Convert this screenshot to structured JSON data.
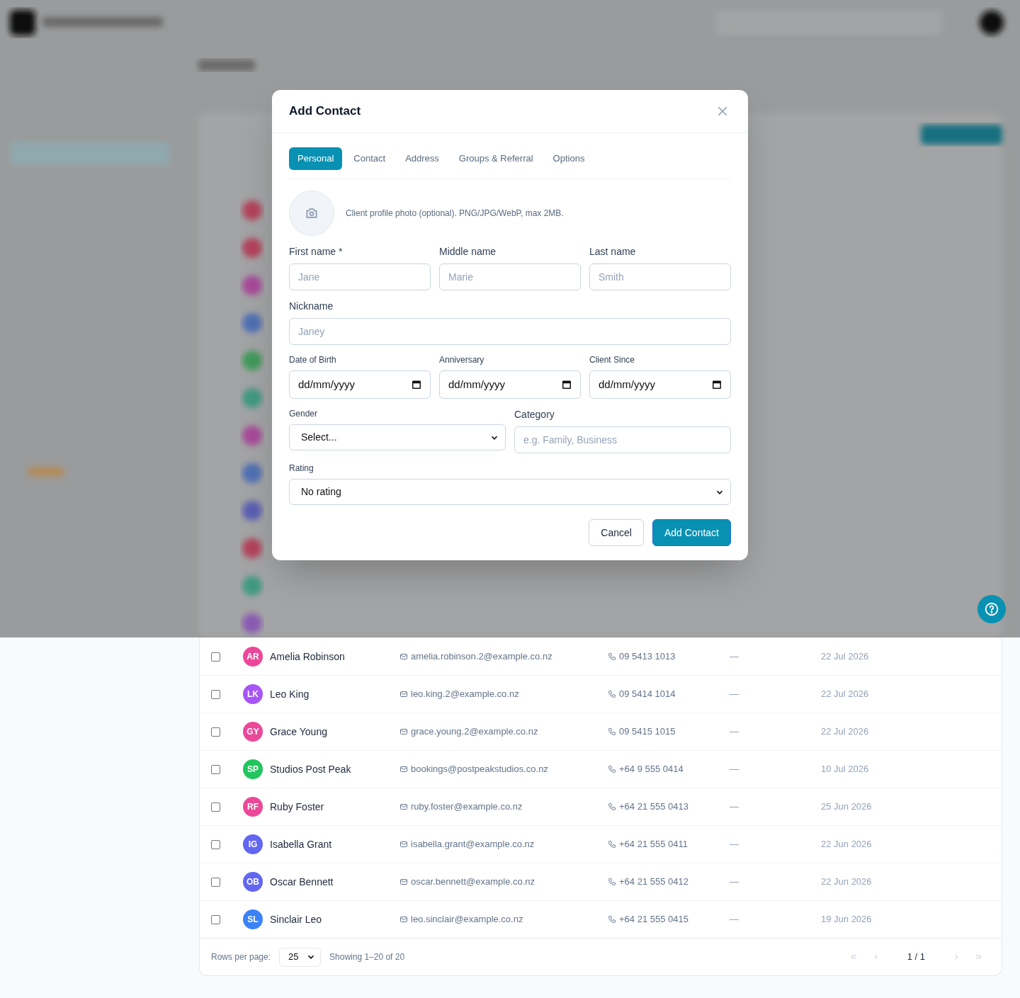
{
  "dialog": {
    "title": "Add Contact",
    "tabs": [
      {
        "label": "Personal",
        "selected": true
      },
      {
        "label": "Contact",
        "selected": false
      },
      {
        "label": "Address",
        "selected": false
      },
      {
        "label": "Groups & Referral",
        "selected": false
      },
      {
        "label": "Options",
        "selected": false
      }
    ],
    "photo_hint": "Client profile photo (optional). PNG/JPG/WebP, max 2MB.",
    "field_rows": [
      [
        {
          "kind": "text",
          "label": "First name *",
          "placeholder": "Jane"
        },
        {
          "kind": "text",
          "label": "Middle name",
          "placeholder": "Marie"
        },
        {
          "kind": "text",
          "label": "Last name",
          "placeholder": "Smith"
        }
      ],
      [
        {
          "kind": "text",
          "label": "Nickname",
          "placeholder": "Janey"
        }
      ],
      [
        {
          "kind": "date",
          "label": "Date of Birth",
          "value": "dd/mm/yyyy"
        },
        {
          "kind": "date",
          "label": "Anniversary",
          "value": "dd/mm/yyyy"
        },
        {
          "kind": "date",
          "label": "Client Since",
          "value": "dd/mm/yyyy"
        }
      ],
      [
        {
          "kind": "select",
          "label": "Gender",
          "value": "Select..."
        },
        {
          "kind": "text",
          "label": "Category",
          "placeholder": "e.g. Family, Business"
        }
      ],
      [
        {
          "kind": "select",
          "label": "Rating",
          "value": "No rating"
        }
      ]
    ],
    "buttons": [
      {
        "label": "Cancel",
        "kind": "secondary"
      },
      {
        "label": "Add Contact",
        "kind": "primary"
      }
    ]
  },
  "table": {
    "rows": [
      {
        "checked": false,
        "initials": "AR",
        "color": "#ec4899",
        "name": "Amelia Robinson",
        "email": "amelia.robinson.2@example.co.nz",
        "phone": "09 5413 1013",
        "tags": "—",
        "created": "22 Jul 2026"
      },
      {
        "checked": false,
        "initials": "LK",
        "color": "#a855f7",
        "name": "Leo King",
        "email": "leo.king.2@example.co.nz",
        "phone": "09 5414 1014",
        "tags": "—",
        "created": "22 Jul 2026"
      },
      {
        "checked": false,
        "initials": "GY",
        "color": "#ec4899",
        "name": "Grace Young",
        "email": "grace.young.2@example.co.nz",
        "phone": "09 5415 1015",
        "tags": "—",
        "created": "22 Jul 2026"
      },
      {
        "checked": false,
        "initials": "SP",
        "color": "#22c55e",
        "name": "Studios Post Peak",
        "email": "bookings@postpeakstudios.co.nz",
        "phone": "+64 9 555 0414",
        "tags": "—",
        "created": "10 Jul 2026"
      },
      {
        "checked": false,
        "initials": "RF",
        "color": "#ec4899",
        "name": "Ruby Foster",
        "email": "ruby.foster@example.co.nz",
        "phone": "+64 21 555 0413",
        "tags": "—",
        "created": "25 Jun 2026"
      },
      {
        "checked": false,
        "initials": "IG",
        "color": "#6366f1",
        "name": "Isabella Grant",
        "email": "isabella.grant@example.co.nz",
        "phone": "+64 21 555 0411",
        "tags": "—",
        "created": "22 Jun 2026"
      },
      {
        "checked": false,
        "initials": "OB",
        "color": "#6366f1",
        "name": "Oscar Bennett",
        "email": "oscar.bennett@example.co.nz",
        "phone": "+64 21 555 0412",
        "tags": "—",
        "created": "22 Jun 2026"
      },
      {
        "checked": false,
        "initials": "SL",
        "color": "#3b82f6",
        "name": "Sinclair Leo",
        "email": "leo.sinclair@example.co.nz",
        "phone": "+64 21 555 0415",
        "tags": "—",
        "created": "19 Jun 2026"
      }
    ],
    "footer": {
      "rows_per_page_label": "Rows per page:",
      "rows_per_page": "25",
      "showing": "Showing 1–20 of 20",
      "page": "1 / 1"
    }
  }
}
